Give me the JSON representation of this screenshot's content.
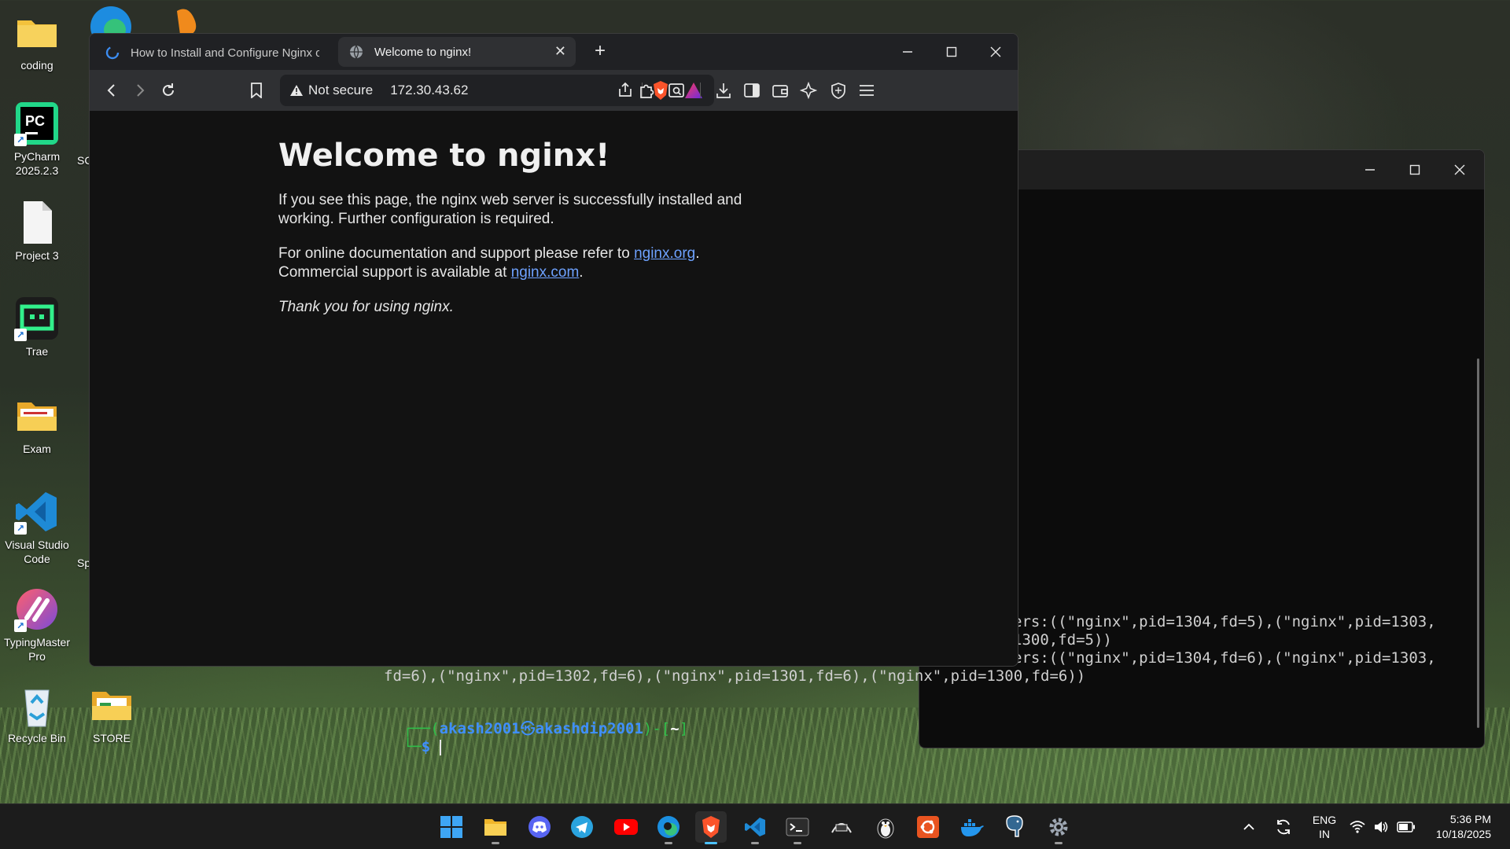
{
  "desktop": {
    "icons": [
      {
        "label": "coding"
      },
      {
        "label": "PyCharm 2025.2.3"
      },
      {
        "label": "Project 3"
      },
      {
        "label": "Trae"
      },
      {
        "label": "Exam"
      },
      {
        "label": "Visual Studio Code"
      },
      {
        "label": "TypingMaster Pro"
      },
      {
        "label": "Recycle Bin"
      },
      {
        "label": "STORE"
      }
    ],
    "partial_labels": [
      "SC",
      "Sp"
    ]
  },
  "browser": {
    "tabs": [
      {
        "title": "How to Install and Configure Nginx o",
        "active": false,
        "icon": "loading-spinner-icon"
      },
      {
        "title": "Welcome to nginx!",
        "active": true,
        "icon": "globe-icon"
      }
    ],
    "url": {
      "security_label": "Not secure",
      "address": "172.30.43.62"
    },
    "page": {
      "heading": "Welcome to nginx!",
      "para1": "If you see this page, the nginx web server is successfully installed and working. Further configuration is required.",
      "para2_prefix": "For online documentation and support please refer to ",
      "link1": "nginx.org",
      "para2_mid": ".",
      "para2_line2_prefix": "Commercial support is available at ",
      "link2": "nginx.com",
      "para2_suffix": ".",
      "thanks": "Thank you for using nginx."
    }
  },
  "terminal": {
    "lines": [
      "ers:((\"nginx\",pid=1304,fd=5),(\"nginx\",pid=1303,",
      "1300,fd=5))",
      "ers:((\"nginx\",pid=1304,fd=6),(\"nginx\",pid=1303,",
      "fd=6),(\"nginx\",pid=1302,fd=6),(\"nginx\",pid=1301,fd=6),(\"nginx\",pid=1300,fd=6))"
    ],
    "prompt_user": "akash2001",
    "prompt_sep": "㉿",
    "prompt_host": "akashdip2001",
    "prompt_dir": "~",
    "prompt_symbol": "$"
  },
  "taskbar": {
    "apps": [
      "start",
      "file-explorer",
      "discord",
      "telegram",
      "youtube",
      "edge",
      "brave",
      "vscode",
      "terminal",
      "wsl",
      "penguin",
      "ubuntu",
      "docker",
      "postgresql",
      "settings"
    ],
    "tray": {
      "language_top": "ENG",
      "language_bottom": "IN",
      "time": "5:36 PM",
      "date": "10/18/2025"
    }
  },
  "colors": {
    "link": "#6ea2ff",
    "terminal_prompt_blue": "#3f8fff",
    "terminal_prompt_green": "#2fbf4a",
    "brave_orange": "#fb542b"
  }
}
